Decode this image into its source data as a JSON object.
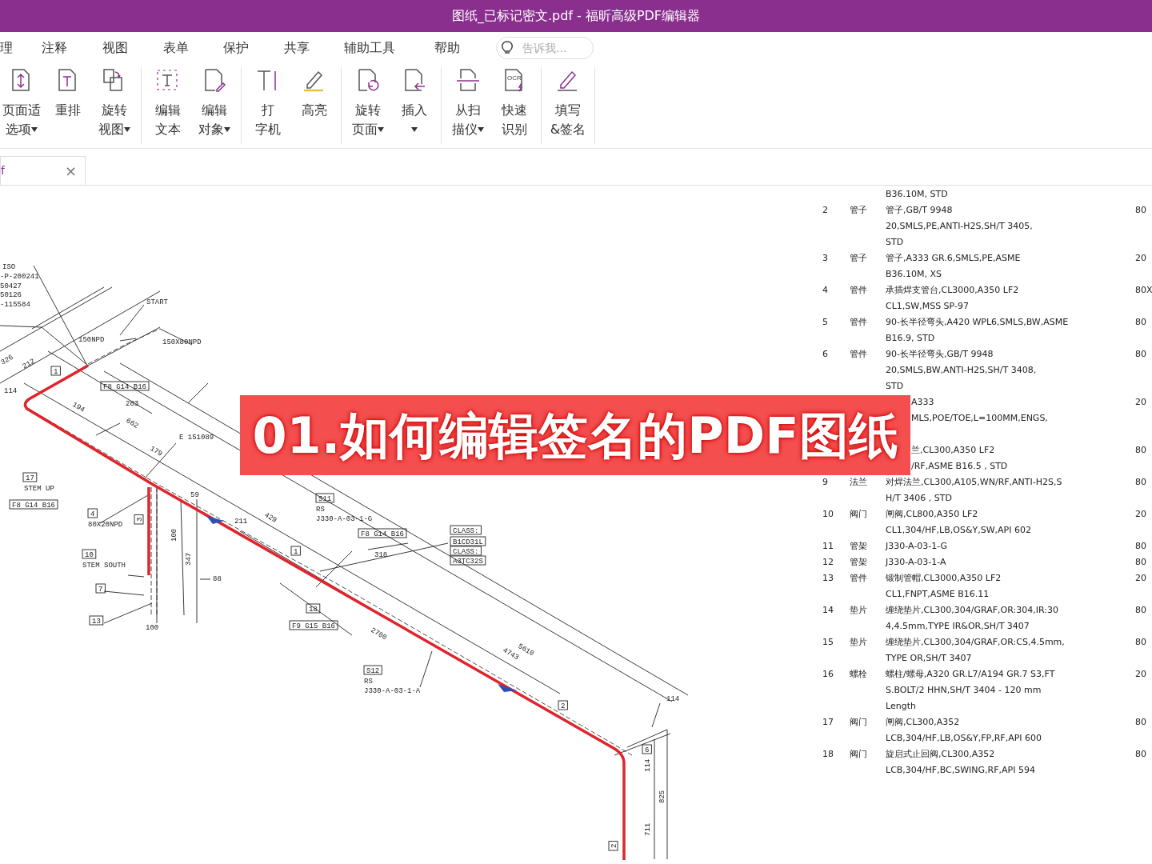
{
  "window": {
    "title": "图纸_已标记密文.pdf - 福昕高级PDF编辑器"
  },
  "menu": [
    {
      "label": "理",
      "selected": false
    },
    {
      "label": "注释",
      "selected": false
    },
    {
      "label": "视图",
      "selected": false
    },
    {
      "label": "表单",
      "selected": false
    },
    {
      "label": "保护",
      "selected": false
    },
    {
      "label": "共享",
      "selected": false
    },
    {
      "label": "辅助工具",
      "selected": false
    },
    {
      "label": "帮助",
      "selected": false
    }
  ],
  "search": {
    "placeholder": "告诉我..."
  },
  "ribbon": [
    {
      "buttons": [
        {
          "lines": [
            "页面适",
            "选项"
          ],
          "dropdown": true
        },
        {
          "lines": [
            "重排"
          ],
          "dropdown": false
        },
        {
          "lines": [
            "旋转",
            "视图"
          ],
          "dropdown": true
        }
      ]
    },
    {
      "buttons": [
        {
          "lines": [
            "编辑",
            "文本"
          ],
          "dropdown": false
        },
        {
          "lines": [
            "编辑",
            "对象"
          ],
          "dropdown": true
        }
      ]
    },
    {
      "buttons": [
        {
          "lines": [
            "打",
            "字机"
          ],
          "dropdown": false
        },
        {
          "lines": [
            "高亮"
          ],
          "dropdown": false
        }
      ]
    },
    {
      "buttons": [
        {
          "lines": [
            "旋转",
            "页面"
          ],
          "dropdown": true
        },
        {
          "lines": [
            "插入"
          ],
          "dropdown": true
        }
      ]
    },
    {
      "buttons": [
        {
          "lines": [
            "从扫",
            "描仪"
          ],
          "dropdown": true
        },
        {
          "icon_text": "OCR",
          "lines": [
            "快速",
            "识别"
          ],
          "dropdown": false
        }
      ]
    },
    {
      "buttons": [
        {
          "lines": [
            "填写",
            "&签名"
          ],
          "dropdown": false
        }
      ]
    }
  ],
  "tabs": [
    {
      "label": "f",
      "selected": true,
      "close": "×"
    }
  ],
  "drawing": {
    "labels": [
      {
        "kind": "plain",
        "text": "ISO"
      },
      {
        "kind": "plain",
        "text": "-P-200241"
      },
      {
        "kind": "plain",
        "text": "50427"
      },
      {
        "kind": "plain",
        "text": "50126"
      },
      {
        "kind": "plain",
        "text": "START"
      },
      {
        "kind": "plain",
        "text": "-115584"
      },
      {
        "kind": "plain",
        "text": "150NPD"
      },
      {
        "kind": "plain",
        "text": "150X80NPD"
      },
      {
        "kind": "plain",
        "text": "326"
      },
      {
        "kind": "plain",
        "text": "212"
      },
      {
        "kind": "boxed",
        "text": "1"
      },
      {
        "kind": "boxed",
        "text": "F8 G14 B16"
      },
      {
        "kind": "plain",
        "text": "114"
      },
      {
        "kind": "plain",
        "text": "194"
      },
      {
        "kind": "plain",
        "text": "283"
      },
      {
        "kind": "plain",
        "text": "662"
      },
      {
        "kind": "plain",
        "text": "E 151089"
      },
      {
        "kind": "plain",
        "text": "179"
      },
      {
        "kind": "boxed",
        "text": "17"
      },
      {
        "kind": "plain",
        "text": "STEM UP"
      },
      {
        "kind": "plain",
        "text": "59"
      },
      {
        "kind": "boxed",
        "text": "S11"
      },
      {
        "kind": "boxed",
        "text": "F8 G14 B16"
      },
      {
        "kind": "plain",
        "text": "RS"
      },
      {
        "kind": "boxed",
        "text": "4"
      },
      {
        "kind": "plain",
        "text": "429"
      },
      {
        "kind": "plain",
        "text": "J330-A-03-1-G"
      },
      {
        "kind": "boxed",
        "text": "3"
      },
      {
        "kind": "plain",
        "text": "211"
      },
      {
        "kind": "plain",
        "text": "80X20NPD"
      },
      {
        "kind": "boxed",
        "text": "CLASS:"
      },
      {
        "kind": "boxed",
        "text": "F8 G14 B16"
      },
      {
        "kind": "plain",
        "text": "100"
      },
      {
        "kind": "boxed",
        "text": "B1CD31L"
      },
      {
        "kind": "boxed",
        "text": "10"
      },
      {
        "kind": "boxed",
        "text": "1"
      },
      {
        "kind": "plain",
        "text": "318"
      },
      {
        "kind": "boxed",
        "text": "CLASS:"
      },
      {
        "kind": "boxed",
        "text": "A3TC32S"
      },
      {
        "kind": "plain",
        "text": "347"
      },
      {
        "kind": "plain",
        "text": "STEM SOUTH"
      },
      {
        "kind": "plain",
        "text": "88"
      },
      {
        "kind": "boxed",
        "text": "7"
      },
      {
        "kind": "boxed",
        "text": "18"
      },
      {
        "kind": "boxed",
        "text": "13"
      },
      {
        "kind": "boxed",
        "text": "F9 G15 B16"
      },
      {
        "kind": "plain",
        "text": "100"
      },
      {
        "kind": "plain",
        "text": "2700"
      },
      {
        "kind": "plain",
        "text": "5610"
      },
      {
        "kind": "plain",
        "text": "4743"
      },
      {
        "kind": "boxed",
        "text": "S12"
      },
      {
        "kind": "plain",
        "text": "RS"
      },
      {
        "kind": "plain",
        "text": "J330-A-03-1-A"
      },
      {
        "kind": "plain",
        "text": "114"
      },
      {
        "kind": "boxed",
        "text": "2"
      },
      {
        "kind": "boxed",
        "text": "6"
      },
      {
        "kind": "plain",
        "text": "114"
      },
      {
        "kind": "plain",
        "text": "825"
      },
      {
        "kind": "plain",
        "text": "711"
      },
      {
        "kind": "boxed",
        "text": "2"
      }
    ]
  },
  "parts_table": {
    "rows": [
      {
        "lines": [
          "B36.10M, STD"
        ]
      },
      {
        "no": "2",
        "name": "管子",
        "lines": [
          "管子,GB/T 9948",
          "20,SMLS,PE,ANTI-H2S,SH/T 3405,",
          "STD"
        ],
        "qty": "80"
      },
      {
        "no": "3",
        "name": "管子",
        "lines": [
          "管子,A333 GR.6,SMLS,PE,ASME",
          "B36.10M, XS"
        ],
        "qty": "20"
      },
      {
        "no": "4",
        "name": "管件",
        "lines": [
          "承插焊支管台,CL3000,A350 LF2",
          "CL1,SW,MSS SP-97"
        ],
        "qty": "80X"
      },
      {
        "no": "5",
        "name": "管件",
        "lines": [
          "90-长半径弯头,A420 WPL6,SMLS,BW,ASME",
          "B16.9, STD"
        ],
        "qty": "80"
      },
      {
        "no": "6",
        "name": "管件",
        "lines": [
          "90-长半径弯头,GB/T 9948",
          "20,SMLS,BW,ANTI-H2S,SH/T 3408,",
          "STD"
        ],
        "qty": "80"
      },
      {
        "covered": true,
        "lines": [
          "A333",
          "MLS,POE/TOE,L=100MM,ENGS,"
        ],
        "qty": "20"
      },
      {
        "covered": true,
        "lines": [
          "兰,CL300,A350 LF2",
          "/RF,ASME B16.5 , STD"
        ],
        "qty": "80"
      },
      {
        "no": "9",
        "name": "法兰",
        "lines": [
          "对焊法兰,CL300,A105,WN/RF,ANTI-H2S,S",
          "H/T 3406 , STD"
        ],
        "qty": "80"
      },
      {
        "no": "10",
        "name": "阀门",
        "lines": [
          "闸阀,CL800,A350 LF2",
          "CL1,304/HF,LB,OS&Y,SW,API 602"
        ],
        "qty": "20"
      },
      {
        "no": "11",
        "name": "管架",
        "lines": [
          "J330-A-03-1-G"
        ],
        "qty": "80"
      },
      {
        "no": "12",
        "name": "管架",
        "lines": [
          "J330-A-03-1-A"
        ],
        "qty": "80"
      },
      {
        "no": "13",
        "name": "管件",
        "lines": [
          "锻制管帽,CL3000,A350 LF2",
          "CL1,FNPT,ASME B16.11"
        ],
        "qty": "20"
      },
      {
        "no": "14",
        "name": "垫片",
        "lines": [
          "缠绕垫片,CL300,304/GRAF,OR:304,IR:30",
          "4,4.5mm,TYPE IR&OR,SH/T 3407"
        ],
        "qty": "80"
      },
      {
        "no": "15",
        "name": "垫片",
        "lines": [
          "缠绕垫片,CL300,304/GRAF,OR:CS,4.5mm,",
          "TYPE OR,SH/T 3407"
        ],
        "qty": "80"
      },
      {
        "no": "16",
        "name": "螺栓",
        "lines": [
          "螺柱/螺母,A320 GR.L7/A194 GR.7 S3,FT",
          "S.BOLT/2 HHN,SH/T 3404 -  120 mm",
          "Length"
        ],
        "qty": "20"
      },
      {
        "no": "17",
        "name": "阀门",
        "lines": [
          "闸阀,CL300,A352",
          "LCB,304/HF,LB,OS&Y,FP,RF,API 600"
        ],
        "qty": "80"
      },
      {
        "no": "18",
        "name": "阀门",
        "lines": [
          "旋启式止回阀,CL300,A352",
          "LCB,304/HF,BC,SWING,RF,API 594"
        ],
        "qty": "80"
      }
    ]
  },
  "banner": {
    "text": "01.如何编辑签名的PDF图纸"
  }
}
